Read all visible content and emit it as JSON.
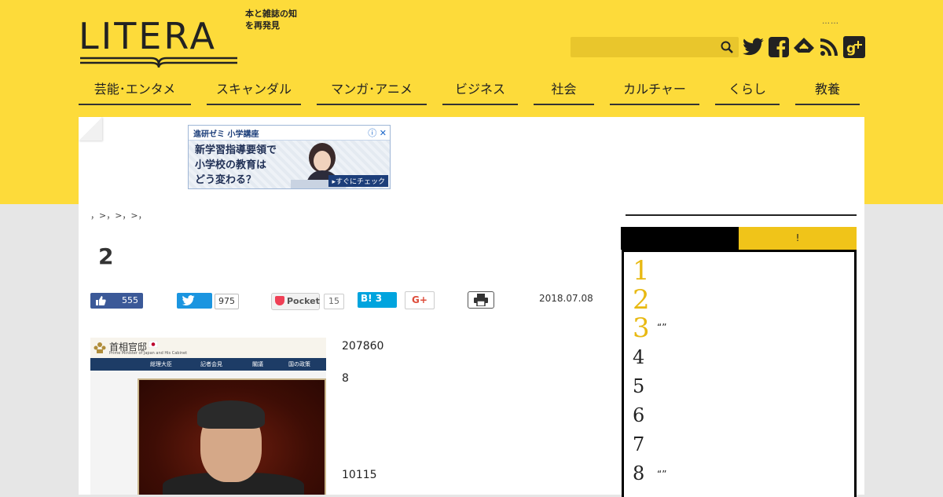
{
  "logo": {
    "word": "LITERA",
    "tagline": "本と雑誌の知を再発見"
  },
  "header": {
    "dots": "……",
    "search_placeholder": ""
  },
  "social": [
    "twitter-icon",
    "facebook-icon",
    "feedly-icon",
    "rss-icon",
    "google-plus-icon"
  ],
  "nav": [
    {
      "label": "芸能･エンタメ"
    },
    {
      "label": "スキャンダル"
    },
    {
      "label": "マンガ･アニメ"
    },
    {
      "label": "ビジネス"
    },
    {
      "label": "社会"
    },
    {
      "label": "カルチャー"
    },
    {
      "label": "くらし"
    },
    {
      "label": "教養"
    }
  ],
  "ad": {
    "brand": "進研ゼミ 小学講座",
    "controls": "ⓘ ✕",
    "line1": "新学習指導要領で",
    "line2": "小学校の教育は",
    "line3": "どう変わる？",
    "cta": "▸すぐにチェック"
  },
  "breadcrumb": "，>，>，>，",
  "article": {
    "title": "2",
    "date": "2018.07.08",
    "numbers": [
      "207860",
      "8",
      "10115"
    ],
    "image": {
      "site_title": "首相官邸",
      "site_sub": "Prime Minister of Japan and His Cabinet",
      "nav": [
        "総理大臣",
        "記者会見",
        "閣議",
        "国の政策"
      ]
    }
  },
  "share": {
    "facebook_count": "555",
    "twitter_count": "975",
    "pocket_label": "Pocket",
    "pocket_count": "15",
    "hatena_label": "B! 3",
    "gplus_label": "G+"
  },
  "sidebar": {
    "tab_a": "",
    "tab_b": "!",
    "ranking": [
      {
        "rank": "1",
        "text": ""
      },
      {
        "rank": "2",
        "text": ""
      },
      {
        "rank": "3",
        "text": "“”"
      },
      {
        "rank": "4",
        "text": ""
      },
      {
        "rank": "5",
        "text": ""
      },
      {
        "rank": "6",
        "text": ""
      },
      {
        "rank": "7",
        "text": ""
      },
      {
        "rank": "8",
        "text": "“”"
      }
    ]
  },
  "colors": {
    "brand_yellow": "#fddb3a",
    "facebook": "#3b5998",
    "twitter": "#1b95e0",
    "hatena": "#00a4de",
    "rank_gold": "#e8b912"
  }
}
